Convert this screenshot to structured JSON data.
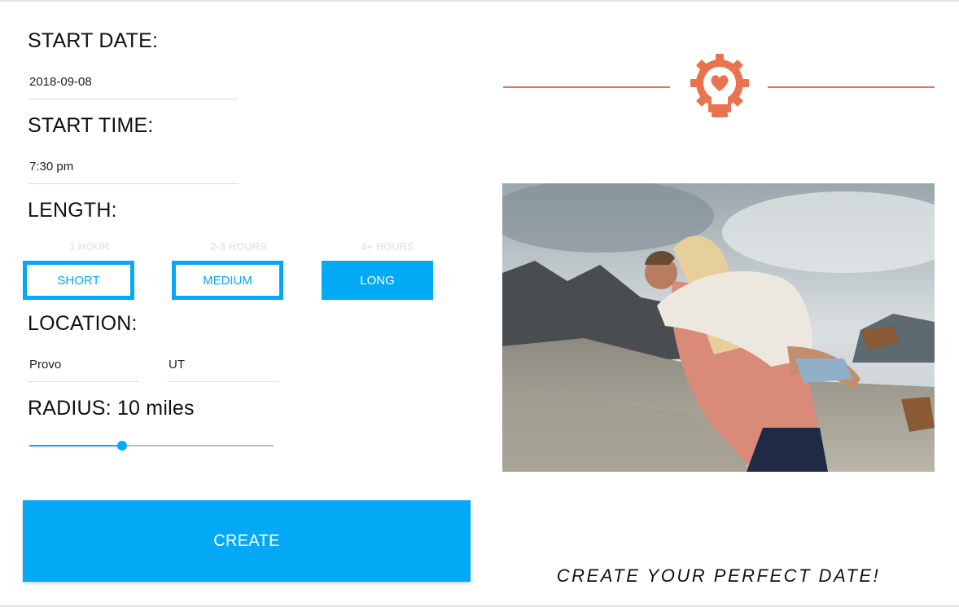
{
  "form": {
    "start_date_label": "START DATE:",
    "start_date_value": "2018-09-08",
    "start_time_label": "START TIME:",
    "start_time_value": "7:30 pm",
    "length_label": "LENGTH:",
    "length_options": [
      {
        "caption": "1 HOUR",
        "label": "SHORT",
        "selected": false
      },
      {
        "caption": "2-3 HOURS",
        "label": "MEDIUM",
        "selected": false
      },
      {
        "caption": "4+ HOURS",
        "label": "LONG",
        "selected": true
      }
    ],
    "location_label": "LOCATION:",
    "city_value": "Provo",
    "state_value": "UT",
    "radius_label": "RADIUS: 10 miles",
    "radius_slider_fraction": 0.38,
    "create_label": "CREATE"
  },
  "brand": {
    "icon": "gear-lightbulb-heart-icon",
    "tagline": "CREATE YOUR PERFECT DATE!"
  },
  "photo": {
    "subject": "couple-embracing-mountain-photo"
  },
  "colors": {
    "accent_blue": "#03a9f4",
    "brand_orange": "#e8734f"
  }
}
